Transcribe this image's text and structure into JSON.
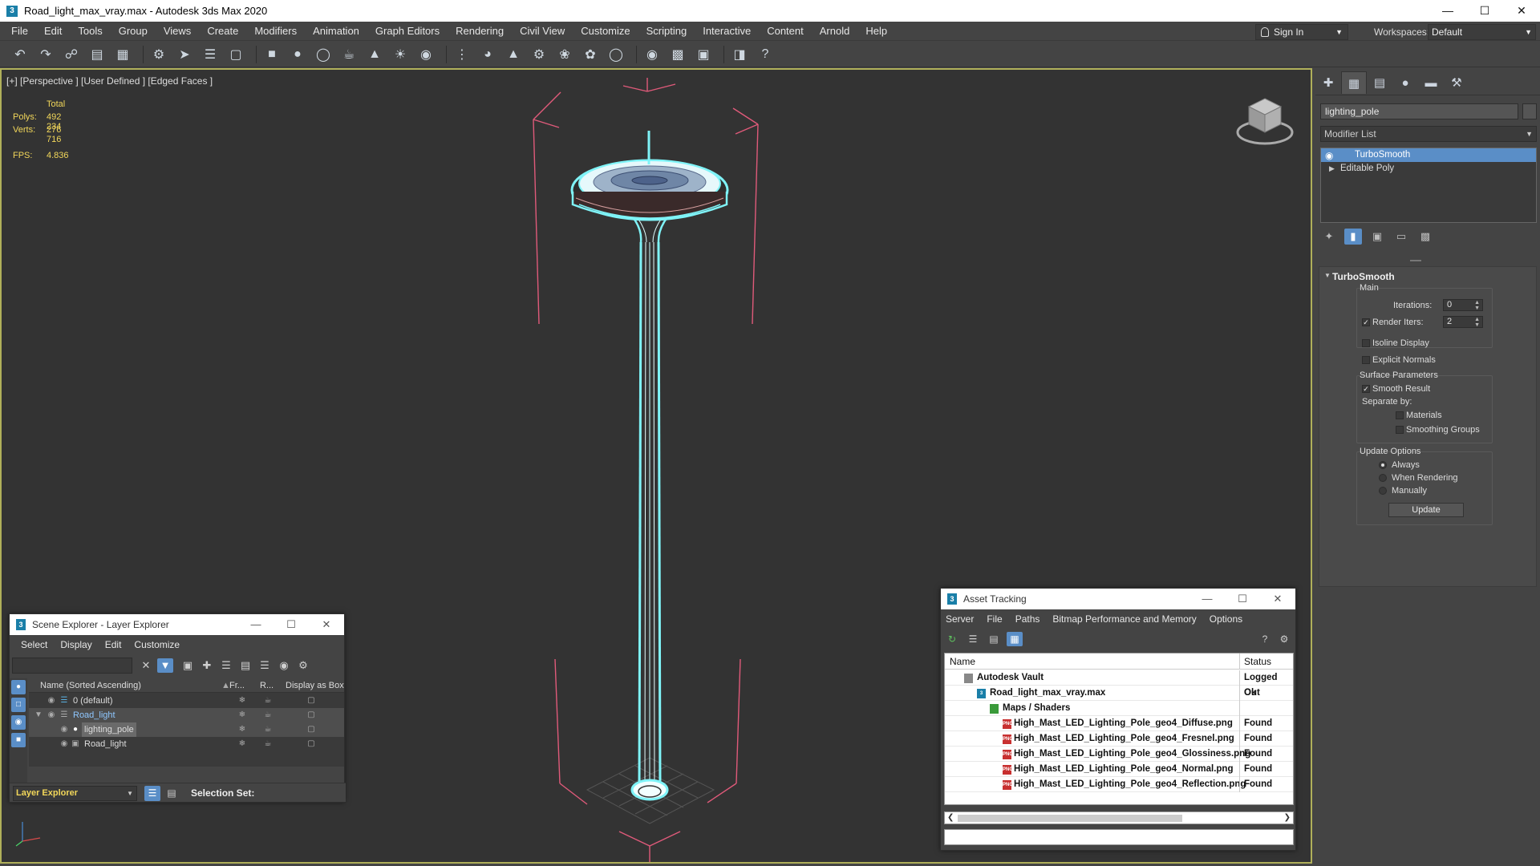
{
  "app": {
    "title": "Road_light_max_vray.max - Autodesk 3ds Max 2020",
    "logo": "3"
  },
  "menubar": {
    "items": [
      "File",
      "Edit",
      "Tools",
      "Group",
      "Views",
      "Create",
      "Modifiers",
      "Animation",
      "Graph Editors",
      "Rendering",
      "Civil View",
      "Customize",
      "Scripting",
      "Interactive",
      "Content",
      "Arnold",
      "Help"
    ]
  },
  "account": {
    "signin": "Sign In",
    "workspaces_label": "Workspaces:",
    "workspace": "Default"
  },
  "viewport": {
    "label": "[+] [Perspective ] [User Defined ] [Edged Faces ]",
    "stats": {
      "total_label": "Total",
      "polys_label": "Polys:",
      "polys": "492 234",
      "verts_label": "Verts:",
      "verts": "276 716",
      "fps_label": "FPS:",
      "fps": "4.836"
    },
    "colors": {
      "wire": "#7ff3f7",
      "bbox": "#e05a7a",
      "frame": "#b0b05a"
    }
  },
  "command_panel": {
    "object_name": "lighting_pole",
    "modifier_list": "Modifier List",
    "stack": [
      {
        "name": "TurboSmooth",
        "selected": true
      },
      {
        "name": "Editable Poly",
        "selected": false
      }
    ],
    "rollout": {
      "title": "TurboSmooth",
      "main_label": "Main",
      "iterations_label": "Iterations:",
      "iterations": "0",
      "render_iters_label": "Render Iters:",
      "render_iters": "2",
      "isoline_display": "Isoline Display",
      "explicit_normals": "Explicit Normals",
      "surface_params": "Surface Parameters",
      "smooth_result": "Smooth Result",
      "separate_by": "Separate by:",
      "materials": "Materials",
      "smoothing_groups": "Smoothing Groups",
      "update_options": "Update Options",
      "always": "Always",
      "when_rendering": "When Rendering",
      "manually": "Manually",
      "update_button": "Update"
    }
  },
  "scene_explorer": {
    "title": "Scene Explorer - Layer Explorer",
    "menu": [
      "Select",
      "Display",
      "Edit",
      "Customize"
    ],
    "columns": {
      "name": "Name (Sorted Ascending)",
      "frozen": "Fr...",
      "render": "R...",
      "box": "Display as Box"
    },
    "rows": [
      {
        "name": "0 (default)"
      },
      {
        "name": "Road_light"
      },
      {
        "name": "lighting_pole"
      },
      {
        "name": "Road_light"
      }
    ],
    "layer_explorer": "Layer Explorer",
    "selection_set": "Selection Set:"
  },
  "asset_tracking": {
    "title": "Asset Tracking",
    "menu": [
      "Server",
      "File",
      "Paths",
      "Bitmap Performance and Memory",
      "Options"
    ],
    "columns": {
      "name": "Name",
      "status": "Status"
    },
    "rows": [
      {
        "name": "Autodesk Vault",
        "status": "Logged Out"
      },
      {
        "name": "Road_light_max_vray.max",
        "status": "Ok"
      },
      {
        "name": "Maps / Shaders",
        "status": ""
      },
      {
        "name": "High_Mast_LED_Lighting_Pole_geo4_Diffuse.png",
        "status": "Found"
      },
      {
        "name": "High_Mast_LED_Lighting_Pole_geo4_Fresnel.png",
        "status": "Found"
      },
      {
        "name": "High_Mast_LED_Lighting_Pole_geo4_Glossiness.png",
        "status": "Found"
      },
      {
        "name": "High_Mast_LED_Lighting_Pole_geo4_Normal.png",
        "status": "Found"
      },
      {
        "name": "High_Mast_LED_Lighting_Pole_geo4_Reflection.png",
        "status": "Found"
      }
    ],
    "file_badge": "PNG"
  }
}
